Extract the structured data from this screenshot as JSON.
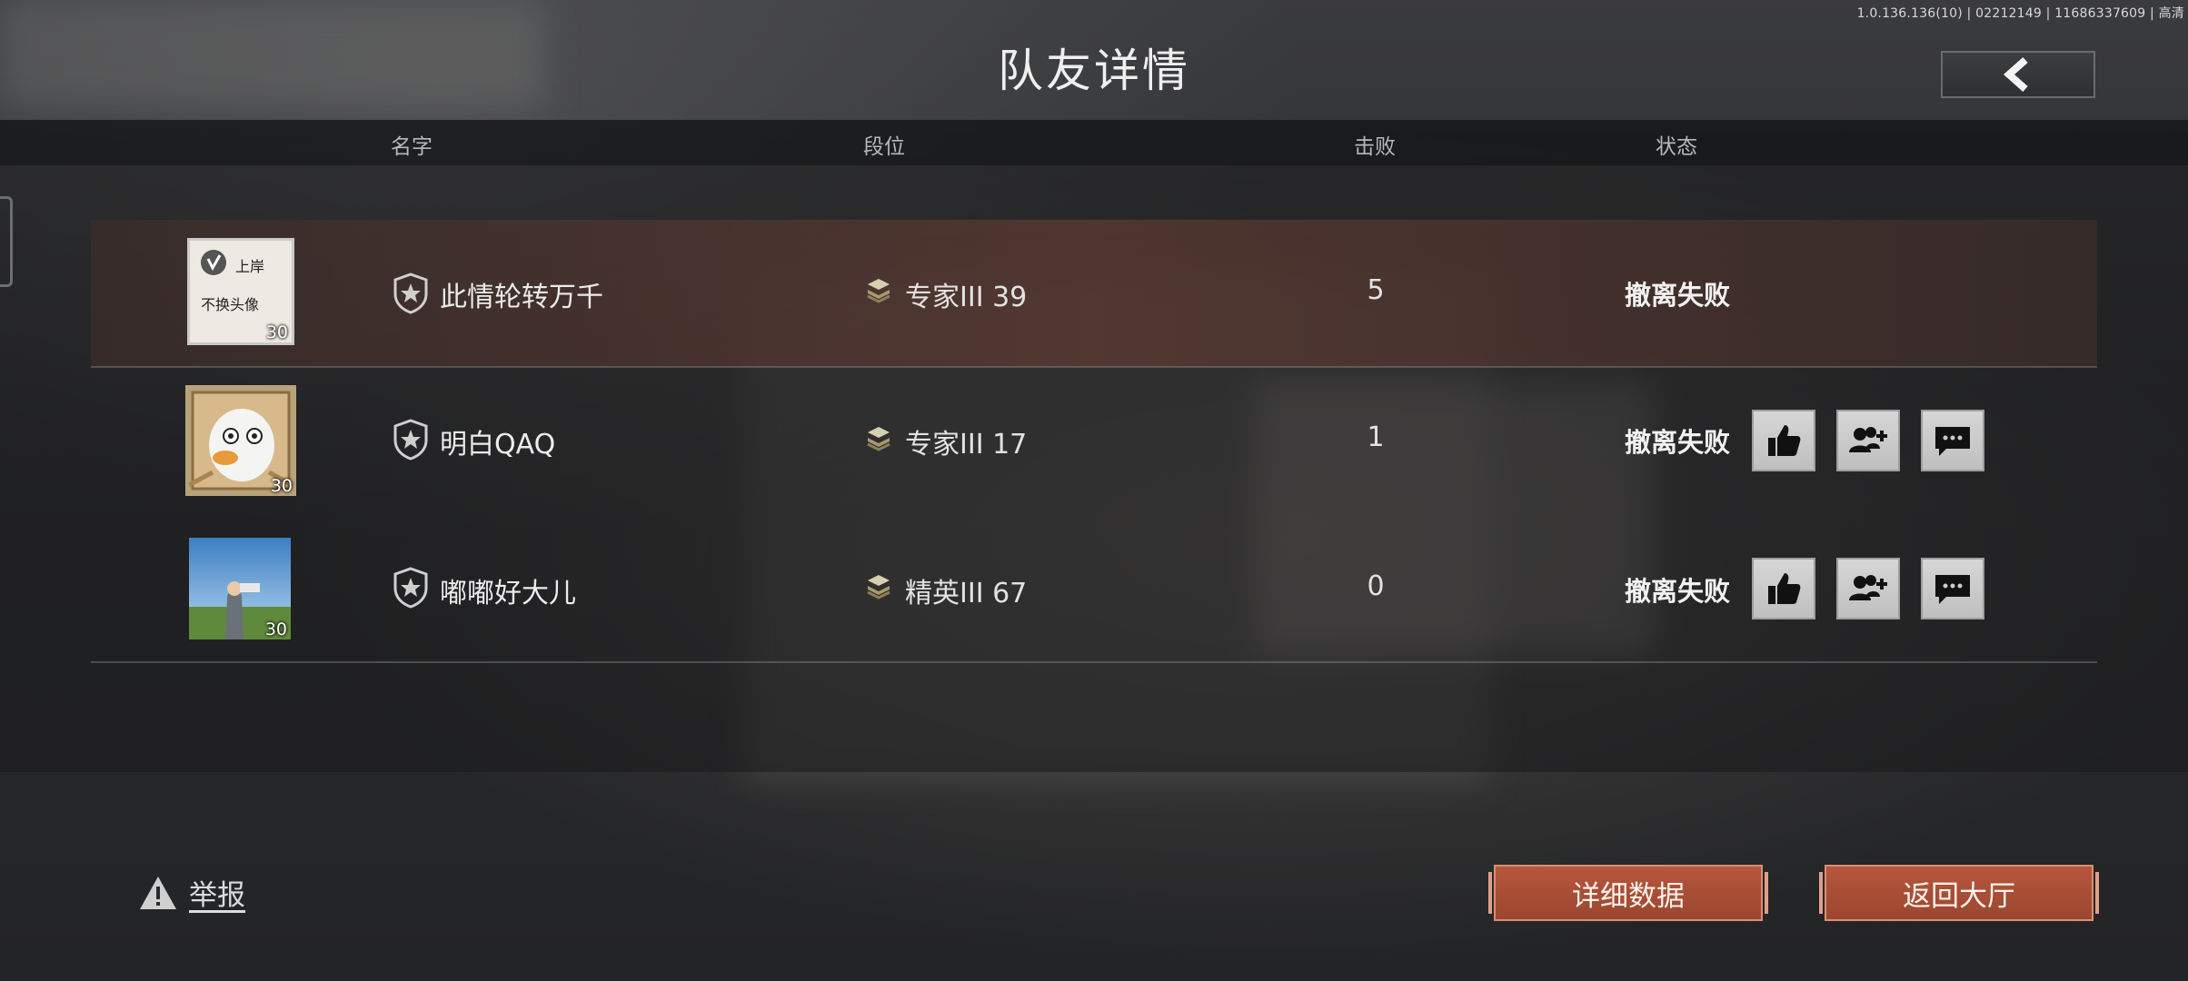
{
  "version_text": "1.0.136.136(10) | 02212149 | 11686337609 | 高清",
  "title": "队友详情",
  "columns": {
    "name": "名字",
    "rank": "段位",
    "kills": "击败",
    "status": "状态"
  },
  "players": [
    {
      "name": "此情轮转万千",
      "rank": "专家III 39",
      "kills": "5",
      "status": "撤离失败",
      "level": "30",
      "avatar_text": "上岸 不换头像"
    },
    {
      "name": "明白QAQ",
      "rank": "专家III 17",
      "kills": "1",
      "status": "撤离失败",
      "level": "30"
    },
    {
      "name": "嘟嘟好大儿",
      "rank": "精英III 67",
      "kills": "0",
      "status": "撤离失败",
      "level": "30"
    }
  ],
  "actions": {
    "like": "thumbs-up-icon",
    "add_friend": "add-friend-icon",
    "chat": "chat-icon"
  },
  "report_label": "举报",
  "buttons": {
    "details": "详细数据",
    "return_lobby": "返回大厅"
  },
  "colors": {
    "accent": "#a84f35",
    "highlight_row": "#6a3a30"
  }
}
